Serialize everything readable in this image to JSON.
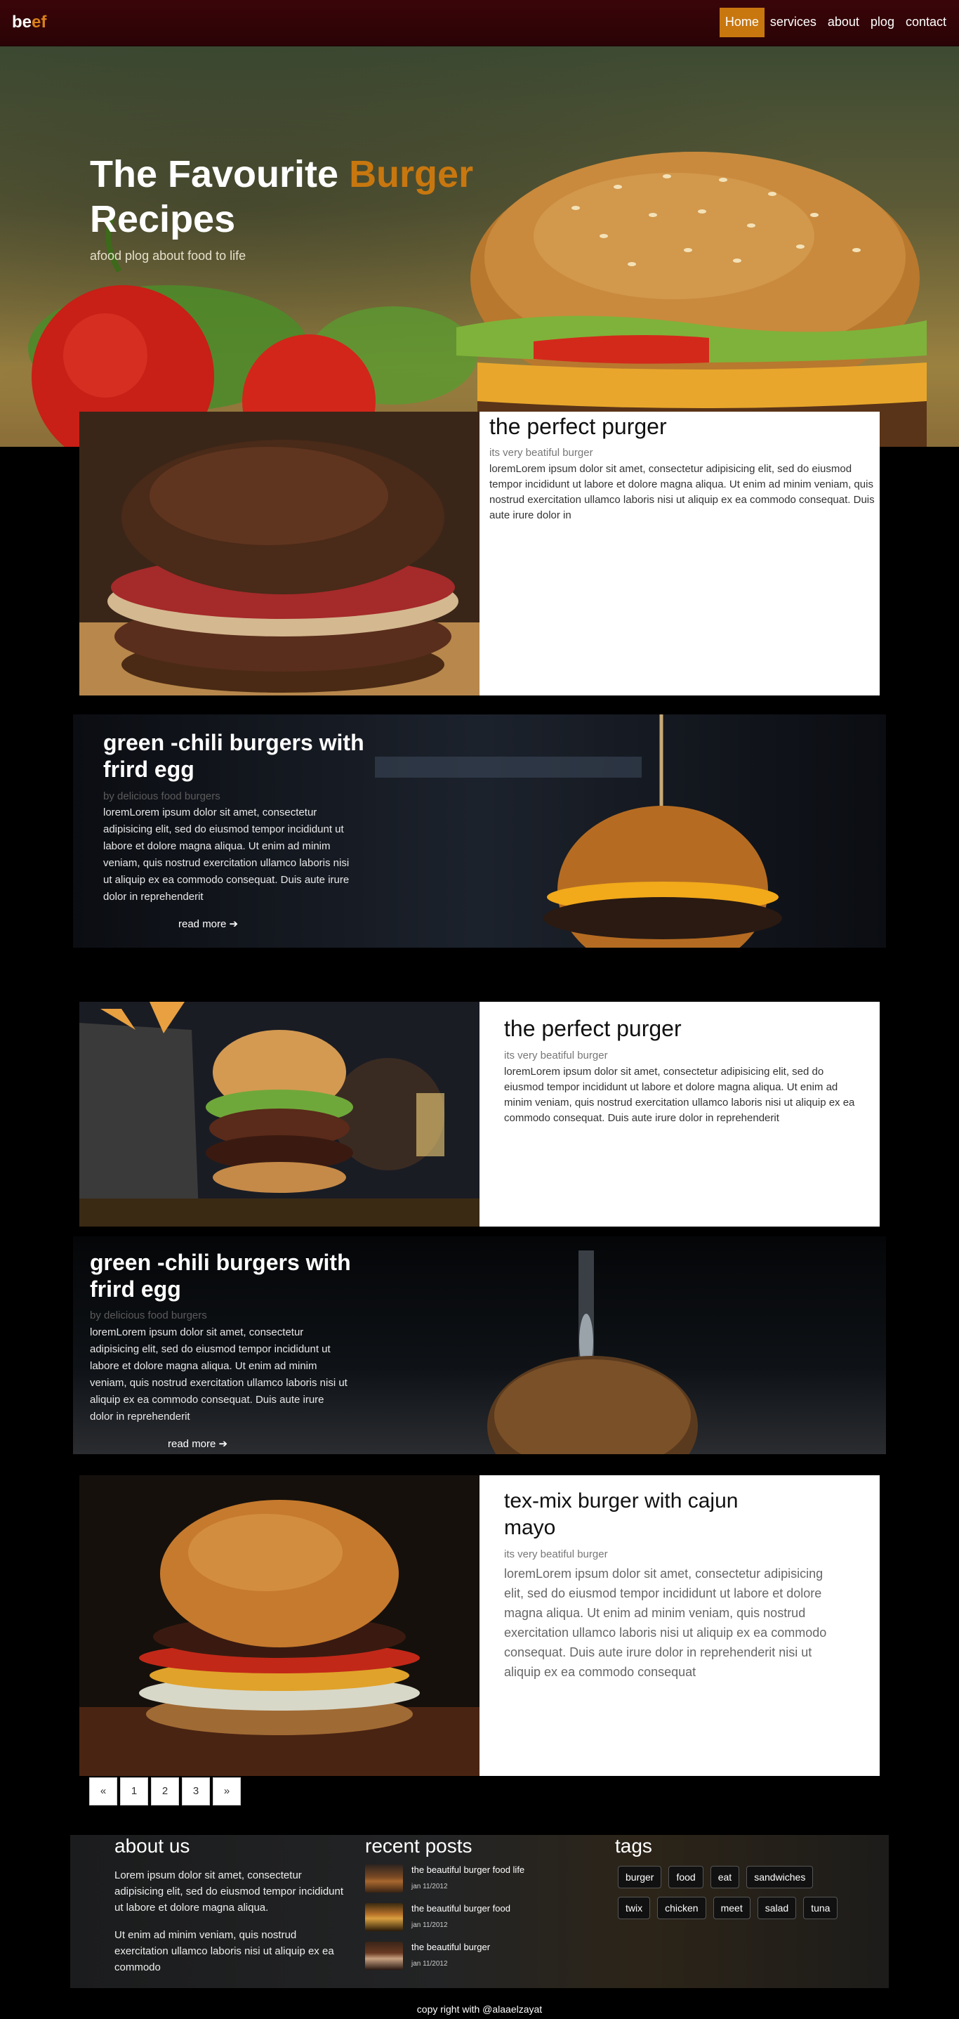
{
  "brand": {
    "part1": "be",
    "part2": "ef"
  },
  "nav": [
    {
      "label": "Home",
      "active": true
    },
    {
      "label": "services",
      "active": false
    },
    {
      "label": "about",
      "active": false
    },
    {
      "label": "plog",
      "active": false
    },
    {
      "label": "contact",
      "active": false
    }
  ],
  "hero": {
    "title_part1": "The Favourite ",
    "title_accent": "Burger",
    "title_part2": "Recipes",
    "subtitle": "afood plog about food to life"
  },
  "posts": {
    "p1": {
      "title": "the perfect purger",
      "meta": "its very beatiful burger",
      "text": "loremLorem ipsum dolor sit amet, consectetur adipisicing elit, sed do eiusmod tempor incididunt ut labore et dolore magna aliqua. Ut enim ad minim veniam, quis nostrud exercitation ullamco laboris nisi ut aliquip ex ea commodo consequat. Duis aute irure dolor in"
    },
    "p2": {
      "title": "green -chili burgers with frird egg",
      "meta": "by delicious food burgers",
      "text": "loremLorem ipsum dolor sit amet, consectetur adipisicing elit, sed do eiusmod tempor incididunt ut labore et dolore magna aliqua. Ut enim ad minim veniam, quis nostrud exercitation ullamco laboris nisi ut aliquip ex ea commodo consequat. Duis aute irure dolor in reprehenderit",
      "more": "read more"
    },
    "p3": {
      "title": "the perfect purger",
      "meta": "its very beatiful burger",
      "text": "loremLorem ipsum dolor sit amet, consectetur adipisicing elit, sed do eiusmod tempor incididunt ut labore et dolore magna aliqua. Ut enim ad minim veniam, quis nostrud exercitation ullamco laboris nisi ut aliquip ex ea commodo consequat. Duis aute irure dolor in reprehenderit"
    },
    "p4": {
      "title": "green -chili burgers with frird egg",
      "meta": "by delicious food burgers",
      "text": "loremLorem ipsum dolor sit amet, consectetur adipisicing elit, sed do eiusmod tempor incididunt ut labore et dolore magna aliqua. Ut enim ad minim veniam, quis nostrud exercitation ullamco laboris nisi ut aliquip ex ea commodo consequat. Duis aute irure dolor in reprehenderit",
      "more": "read more"
    },
    "p5": {
      "title": "tex-mix burger with cajun mayo",
      "meta": "its very beatiful burger",
      "text": "loremLorem ipsum dolor sit amet, consectetur adipisicing elit, sed do eiusmod tempor incididunt ut labore et dolore magna aliqua. Ut enim ad minim veniam, quis nostrud exercitation ullamco laboris nisi ut aliquip ex ea commodo consequat. Duis aute irure dolor in reprehenderit nisi ut aliquip ex ea commodo consequat"
    }
  },
  "pagination": [
    "«",
    "1",
    "2",
    "3",
    "»"
  ],
  "footer": {
    "about_title": "about us",
    "about_p1": "Lorem ipsum dolor sit amet, consectetur adipisicing elit, sed do eiusmod tempor incididunt ut labore et dolore magna aliqua.",
    "about_p2": "Ut enim ad minim veniam, quis nostrud exercitation ullamco laboris nisi ut aliquip ex ea commodo",
    "recent_title": "recent posts",
    "recent": [
      {
        "title": "the beautiful burger food life",
        "date": "jan 11/2012"
      },
      {
        "title": "the beautiful burger food",
        "date": "jan 11/2012"
      },
      {
        "title": "the beautiful burger",
        "date": "jan 11/2012"
      }
    ],
    "tags_title": "tags",
    "tags": [
      "burger",
      "food",
      "eat",
      "sandwiches",
      "twix",
      "chicken",
      "meet",
      "salad",
      "tuna"
    ]
  },
  "copyright": "copy right with @alaaelzayat"
}
